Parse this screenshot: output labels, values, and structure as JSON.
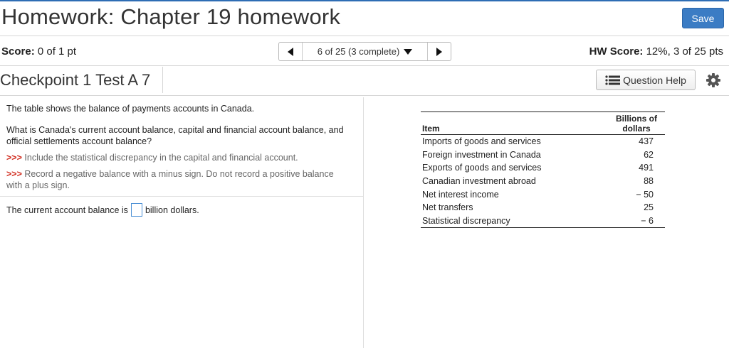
{
  "header": {
    "title": "Homework: Chapter 19 homework",
    "save_label": "Save"
  },
  "score_bar": {
    "score_label": "Score:",
    "score_value": "0 of 1 pt",
    "nav_label": "6 of 25 (3 complete)",
    "hw_score_label": "HW Score:",
    "hw_score_value": "12%, 3 of 25 pts"
  },
  "question_bar": {
    "checkpoint_title": "Checkpoint 1 Test A 7",
    "help_label": "Question Help"
  },
  "question": {
    "intro": "The table shows the balance of payments accounts in Canada.",
    "prompt": "What is Canada's current account balance, capital and financial account balance, and official settlements account balance?",
    "hint_marker": ">>>",
    "hint1": "Include the statistical discrepancy in the capital and financial account.",
    "hint2": "Record a negative balance with a minus sign. Do not record a positive balance with a plus sign.",
    "answer_prefix": "The current account balance is",
    "answer_value": "",
    "answer_suffix": "billion dollars."
  },
  "table": {
    "col_item": "Item",
    "col_value_line1": "Billions of",
    "col_value_line2": "dollars",
    "rows": [
      {
        "item": "Imports of goods and services",
        "value": "437"
      },
      {
        "item": "Foreign investment in Canada",
        "value": "62"
      },
      {
        "item": "Exports of goods and services",
        "value": "491"
      },
      {
        "item": "Canadian investment abroad",
        "value": "88"
      },
      {
        "item": "Net interest income",
        "value": "− 50"
      },
      {
        "item": "Net transfers",
        "value": "25"
      },
      {
        "item": "Statistical discrepancy",
        "value": "− 6"
      }
    ]
  },
  "colors": {
    "accent": "#3b7cc4",
    "hint_marker": "#d12c1e"
  },
  "icons": {
    "prev": "triangle-left-icon",
    "next": "triangle-right-icon",
    "dropdown": "triangle-down-icon",
    "help": "list-icon",
    "settings": "gear-icon"
  }
}
